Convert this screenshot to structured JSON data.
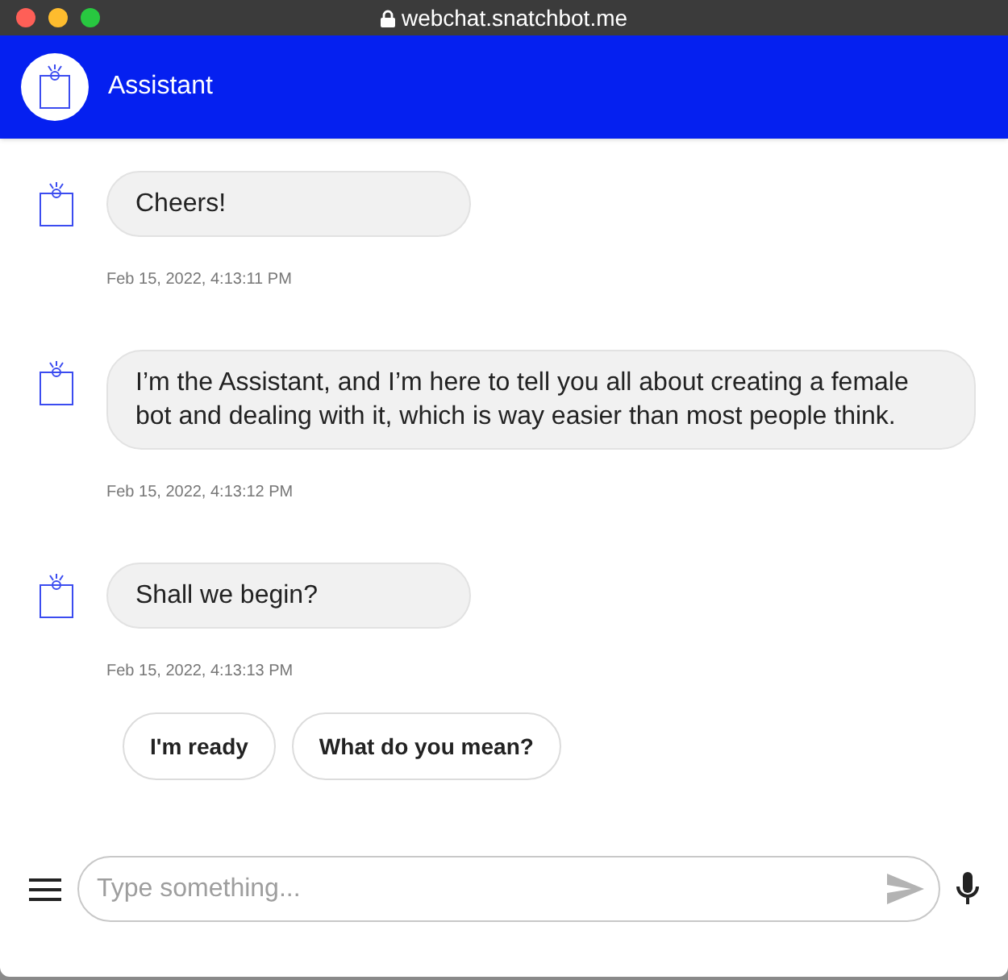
{
  "window": {
    "title": "webchat.snatchbot.me"
  },
  "header": {
    "bot_name": "Assistant"
  },
  "messages": [
    {
      "text": "Cheers!",
      "time": "Feb 15, 2022, 4:13:11 PM"
    },
    {
      "text": "I’m the Assistant, and I’m here to tell you all about creating a female bot and dealing with it, which is way easier than most people think.",
      "time": "Feb 15, 2022, 4:13:12 PM"
    },
    {
      "text": "Shall we begin?",
      "time": "Feb 15, 2022, 4:13:13 PM"
    }
  ],
  "quick_replies": [
    "I'm ready",
    "What do you mean?"
  ],
  "composer": {
    "placeholder": "Type something..."
  }
}
